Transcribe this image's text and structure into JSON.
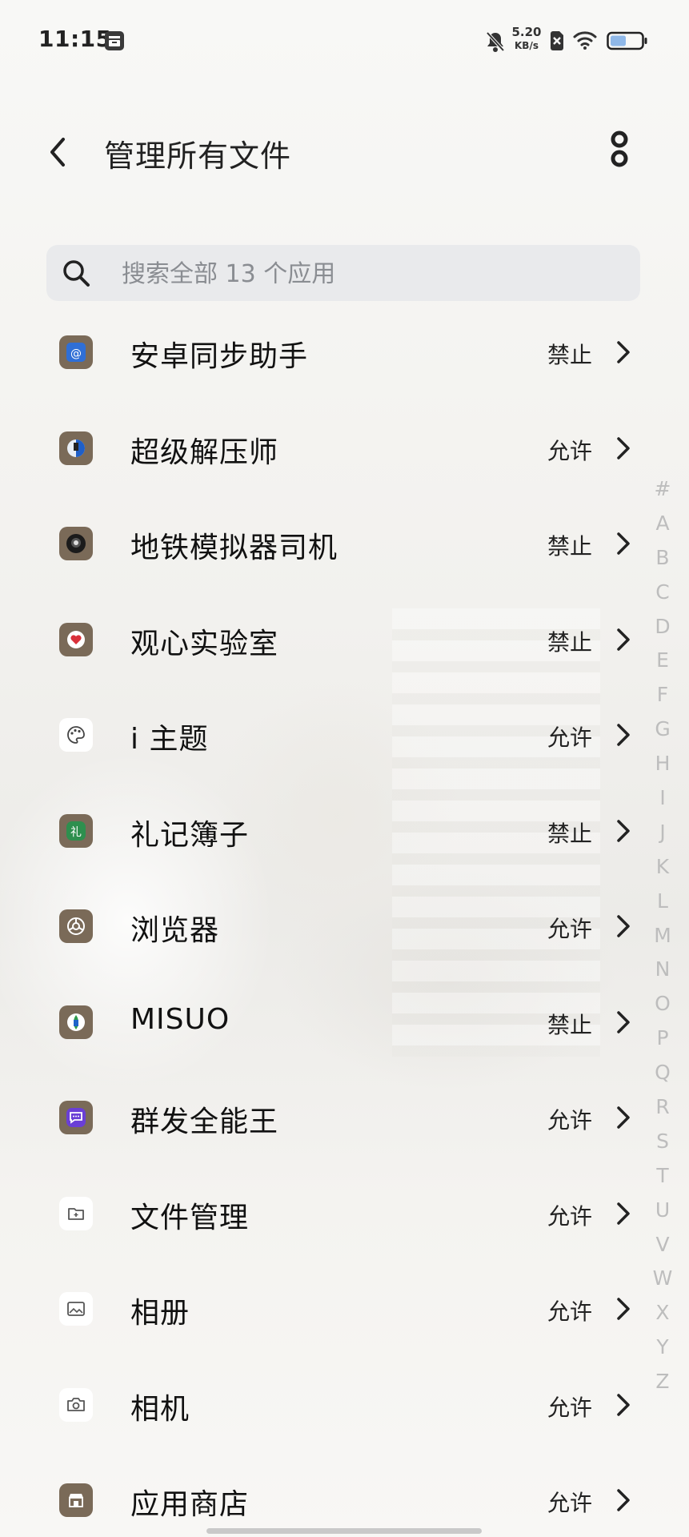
{
  "status_bar": {
    "time": "11:15",
    "net_speed_value": "5.20",
    "net_speed_unit": "KB/s",
    "battery_level_percent": 45
  },
  "header": {
    "title": "管理所有文件"
  },
  "search": {
    "placeholder": "搜索全部 13 个应用"
  },
  "apps": [
    {
      "name": "安卓同步助手",
      "status": "禁止",
      "icon": "sync-app-icon",
      "icon_color": "#7a6a58"
    },
    {
      "name": "超级解压师",
      "status": "允许",
      "icon": "unzip-app-icon",
      "icon_color": "#7a6a58"
    },
    {
      "name": "地铁模拟器司机",
      "status": "禁止",
      "icon": "metro-app-icon",
      "icon_color": "#7a6a58"
    },
    {
      "name": "观心实验室",
      "status": "禁止",
      "icon": "heart-app-icon",
      "icon_color": "#7a6a58"
    },
    {
      "name": "i 主题",
      "status": "允许",
      "icon": "palette-app-icon",
      "icon_color": "#ffffff"
    },
    {
      "name": "礼记簿子",
      "status": "禁止",
      "icon": "gift-book-app-icon",
      "icon_color": "#7a6a58"
    },
    {
      "name": "浏览器",
      "status": "允许",
      "icon": "browser-app-icon",
      "icon_color": "#7a6a58"
    },
    {
      "name": "MISUO",
      "status": "禁止",
      "icon": "misuo-app-icon",
      "icon_color": "#7a6a58"
    },
    {
      "name": "群发全能王",
      "status": "允许",
      "icon": "message-app-icon",
      "icon_color": "#7a6a58"
    },
    {
      "name": "文件管理",
      "status": "允许",
      "icon": "folder-app-icon",
      "icon_color": "#ffffff"
    },
    {
      "name": "相册",
      "status": "允许",
      "icon": "gallery-app-icon",
      "icon_color": "#ffffff"
    },
    {
      "name": "相机",
      "status": "允许",
      "icon": "camera-app-icon",
      "icon_color": "#ffffff"
    },
    {
      "name": "应用商店",
      "status": "允许",
      "icon": "store-app-icon",
      "icon_color": "#7a6a58"
    }
  ],
  "alphabet_index": [
    "#",
    "A",
    "B",
    "C",
    "D",
    "E",
    "F",
    "G",
    "H",
    "I",
    "J",
    "K",
    "L",
    "M",
    "N",
    "O",
    "P",
    "Q",
    "R",
    "S",
    "T",
    "U",
    "V",
    "W",
    "X",
    "Y",
    "Z"
  ]
}
